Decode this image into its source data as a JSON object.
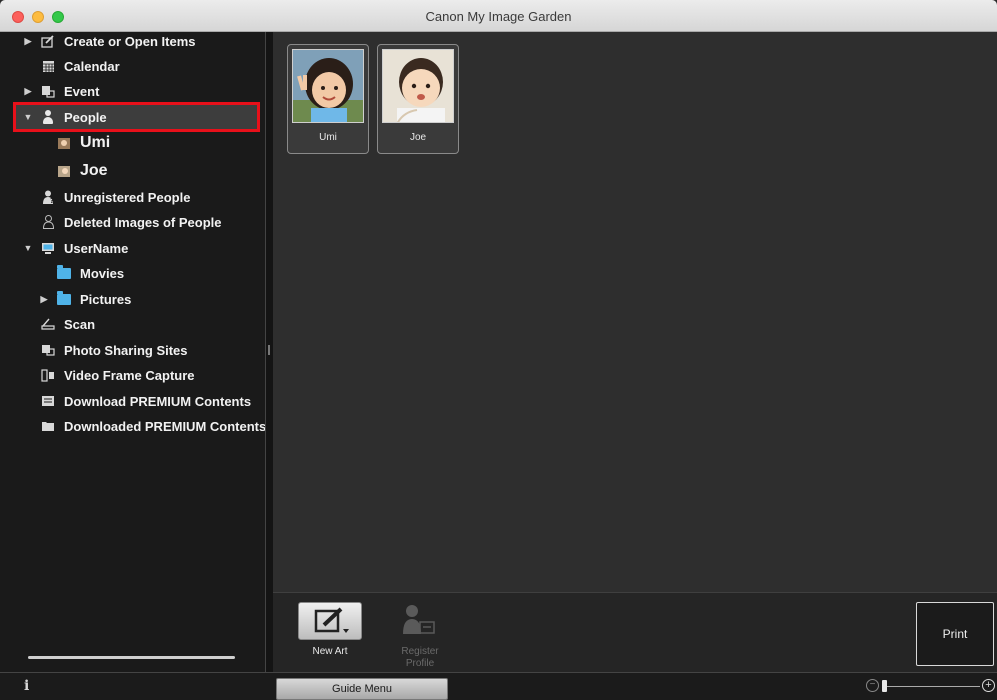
{
  "window": {
    "title": "Canon My Image Garden"
  },
  "sidebar": {
    "items": [
      {
        "label": "Create or Open Items",
        "icon": "edit-icon",
        "expand": "collapsed"
      },
      {
        "label": "Calendar",
        "icon": "calendar-icon",
        "expand": "none"
      },
      {
        "label": "Event",
        "icon": "event-icon",
        "expand": "collapsed"
      },
      {
        "label": "People",
        "icon": "person-icon",
        "expand": "expanded",
        "selected": true
      },
      {
        "label": "Umi",
        "icon": "photo-icon",
        "expand": "none"
      },
      {
        "label": "Joe",
        "icon": "photo-icon",
        "expand": "none"
      },
      {
        "label": "Unregistered People",
        "icon": "unregistered-person-icon",
        "expand": "none"
      },
      {
        "label": "Deleted Images of People",
        "icon": "deleted-person-icon",
        "expand": "none"
      },
      {
        "label": "UserName",
        "icon": "computer-icon",
        "expand": "expanded"
      },
      {
        "label": "Movies",
        "icon": "folder-icon",
        "expand": "none"
      },
      {
        "label": "Pictures",
        "icon": "folder-icon",
        "expand": "collapsed"
      },
      {
        "label": "Scan",
        "icon": "scanner-icon",
        "expand": "none"
      },
      {
        "label": "Photo Sharing Sites",
        "icon": "photo-sharing-icon",
        "expand": "none"
      },
      {
        "label": "Video Frame Capture",
        "icon": "video-capture-icon",
        "expand": "none"
      },
      {
        "label": "Download PREMIUM Contents",
        "icon": "download-icon",
        "expand": "none"
      },
      {
        "label": "Downloaded PREMIUM Contents",
        "icon": "downloaded-folder-icon",
        "expand": "none"
      }
    ]
  },
  "main": {
    "people": [
      {
        "name": "Umi"
      },
      {
        "name": "Joe"
      }
    ]
  },
  "toolbar": {
    "new_art_label": "New Art",
    "register_profile_label": "Register\nProfile",
    "print_label": "Print"
  },
  "statusbar": {
    "info_glyph": "i",
    "guide_menu_label": "Guide Menu",
    "zoom_out_glyph": "−",
    "zoom_in_glyph": "+",
    "zoom_level": 0
  },
  "colors": {
    "selection_highlight": "#e8101a",
    "folder": "#4fb3e8"
  }
}
